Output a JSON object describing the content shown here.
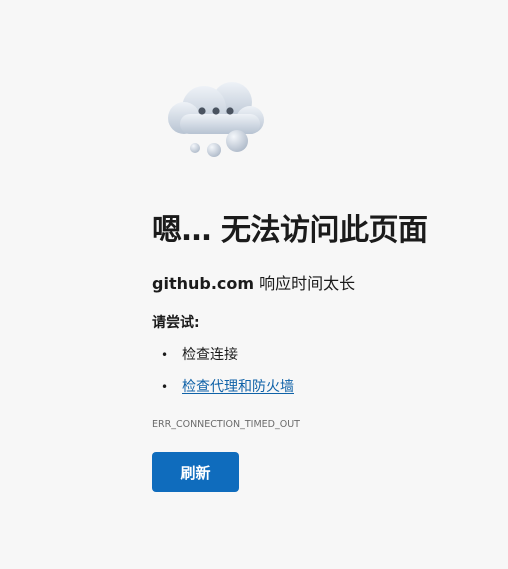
{
  "error_page": {
    "icon": "cloud-error-icon",
    "headline": "嗯… 无法访问此页面",
    "host": "github.com",
    "host_message": " 响应时间太长",
    "try_label": "请尝试:",
    "suggestions": [
      {
        "text": "检查连接",
        "link": false
      },
      {
        "text": "检查代理和防火墙",
        "link": true
      }
    ],
    "error_code": "ERR_CONNECTION_TIMED_OUT",
    "reload_label": "刷新"
  },
  "colors": {
    "background": "#f7f7f7",
    "button": "#0f6cbd",
    "link": "#0f62a8",
    "text": "#1b1b1b"
  }
}
